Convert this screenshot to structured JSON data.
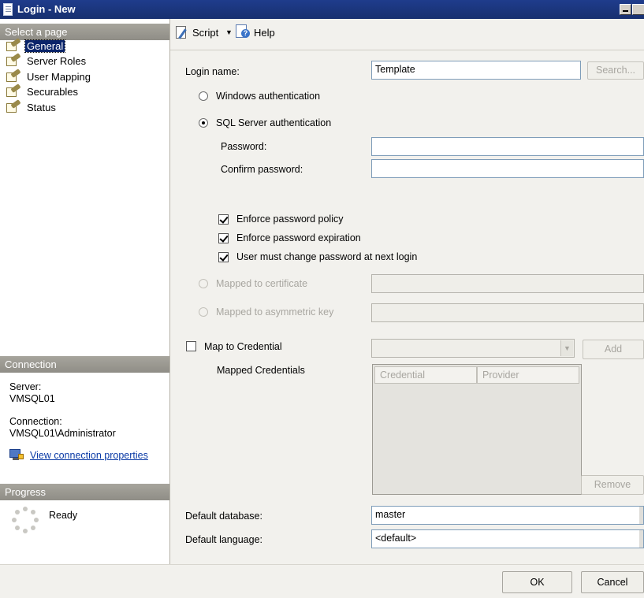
{
  "window": {
    "title": "Login - New"
  },
  "sidebar": {
    "select_page_header": "Select a page",
    "pages": [
      {
        "label": "General",
        "selected": true
      },
      {
        "label": "Server Roles",
        "selected": false
      },
      {
        "label": "User Mapping",
        "selected": false
      },
      {
        "label": "Securables",
        "selected": false
      },
      {
        "label": "Status",
        "selected": false
      }
    ],
    "connection": {
      "header": "Connection",
      "server_label": "Server:",
      "server_value": "VMSQL01",
      "connection_label": "Connection:",
      "connection_value": "VMSQL01\\Administrator",
      "view_link": "View connection properties"
    },
    "progress": {
      "header": "Progress",
      "status": "Ready"
    }
  },
  "toolbar": {
    "script_label": "Script",
    "help_label": "Help"
  },
  "form": {
    "login_name_label": "Login name:",
    "login_name_value": "Template",
    "search_button": "Search...",
    "windows_auth_label": "Windows authentication",
    "sql_auth_label": "SQL Server authentication",
    "password_label": "Password:",
    "password_value": "",
    "confirm_password_label": "Confirm password:",
    "confirm_password_value": "",
    "enforce_policy_label": "Enforce password policy",
    "enforce_expiration_label": "Enforce password expiration",
    "must_change_label": "User must change password at next login",
    "mapped_cert_label": "Mapped to certificate",
    "mapped_key_label": "Mapped to asymmetric key",
    "map_credential_label": "Map to Credential",
    "add_button": "Add",
    "mapped_credentials_label": "Mapped Credentials",
    "grid_columns": [
      "Credential",
      "Provider"
    ],
    "remove_button": "Remove",
    "default_database_label": "Default database:",
    "default_database_value": "master",
    "default_language_label": "Default language:",
    "default_language_value": "<default>"
  },
  "footer": {
    "ok_button": "OK",
    "cancel_button": "Cancel"
  },
  "colors": {
    "titlebar": "#1f3c8c",
    "selection": "#0a246a",
    "panel_header": "#9a988f",
    "link": "#0a3aa6"
  }
}
